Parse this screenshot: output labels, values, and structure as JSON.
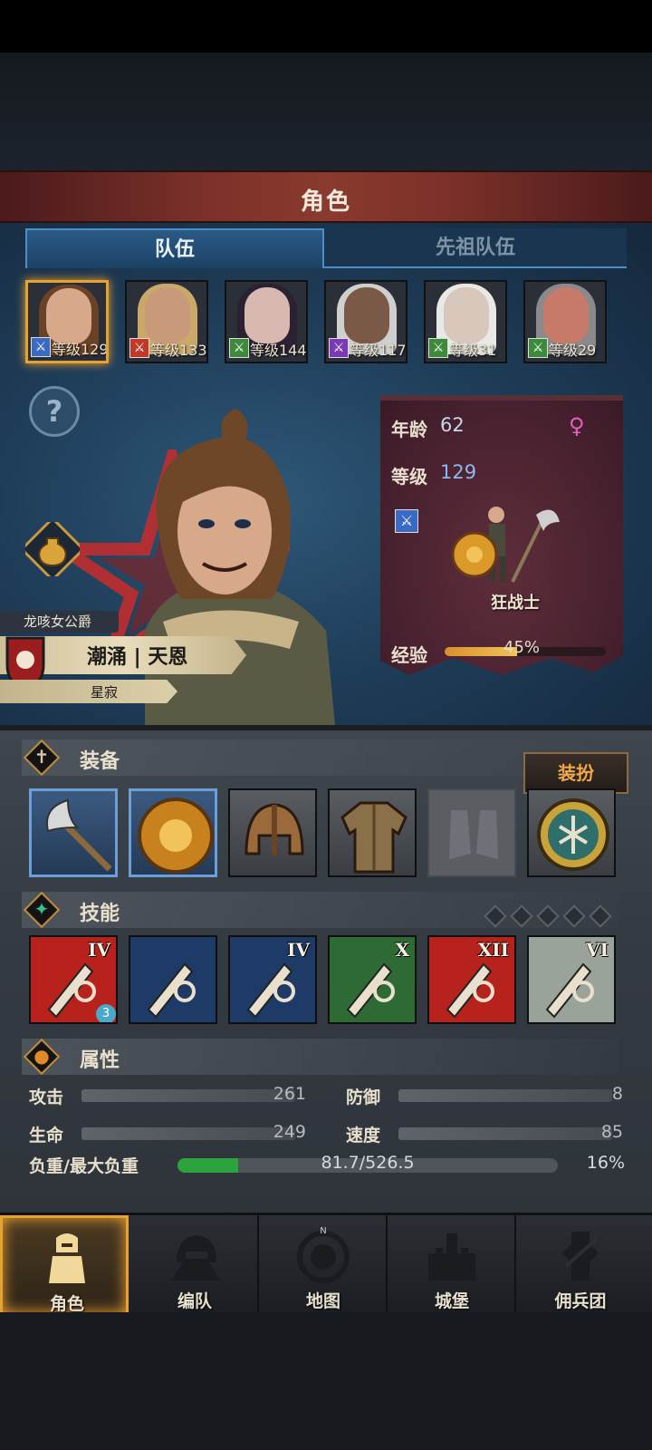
{
  "header": {
    "title": "角色"
  },
  "tabs": {
    "team": "队伍",
    "ancestors": "先祖队伍"
  },
  "roster": [
    {
      "level": "等级129",
      "badge_color": "#3a6bc4",
      "hair": "#6a4228",
      "skin": "#d7a88a",
      "selected": true
    },
    {
      "level": "等级133",
      "badge_color": "#c03a2a",
      "hair": "#c9a86a",
      "skin": "#c99a7a",
      "selected": false
    },
    {
      "level": "等级144",
      "badge_color": "#3c8a3a",
      "hair": "#2a2232",
      "skin": "#d8b8b0",
      "selected": false
    },
    {
      "level": "等级117",
      "badge_color": "#7a3ab4",
      "hair": "#cfcfd0",
      "skin": "#7a5a46",
      "selected": false
    },
    {
      "level": "等级31",
      "badge_color": "#3c8a3a",
      "hair": "#e8e8e6",
      "skin": "#d8c8bc",
      "selected": false
    },
    {
      "level": "等级29",
      "badge_color": "#3c8a3a",
      "hair": "#8a8a8c",
      "skin": "#c87a6a",
      "selected": false
    }
  ],
  "hero": {
    "title_tag": "龙咳女公爵",
    "name": "潮涌 | 天恩",
    "subtitle": "星寂"
  },
  "info": {
    "age_label": "年龄",
    "age": "62",
    "level_label": "等级",
    "level": "129",
    "class_name": "狂战士",
    "xp_label": "经验",
    "xp_text": "45%",
    "xp_fraction": 0.45
  },
  "equipment": {
    "title": "装备",
    "outfit_button": "装扮"
  },
  "skills": {
    "title": "技能",
    "items": [
      {
        "tier": "IV",
        "bg": "#b8221c"
      },
      {
        "tier": "",
        "bg": "#1e3a66"
      },
      {
        "tier": "IV",
        "bg": "#1e3a66"
      },
      {
        "tier": "X",
        "bg": "#2e6a34"
      },
      {
        "tier": "XII",
        "bg": "#b8221c"
      },
      {
        "tier": "VI",
        "bg": "#9aa39a"
      }
    ],
    "skill_badge": "3"
  },
  "attributes": {
    "title": "属性",
    "attack_label": "攻击",
    "attack": "261",
    "defense_label": "防御",
    "defense": "8",
    "hp_label": "生命",
    "hp": "249",
    "speed_label": "速度",
    "speed": "85",
    "load_label": "负重/最大负重",
    "load": "81.7/526.5",
    "load_pct": "16%",
    "load_fraction": 0.16
  },
  "nav": [
    {
      "label": "角色",
      "active": true
    },
    {
      "label": "编队",
      "active": false
    },
    {
      "label": "地图",
      "active": false
    },
    {
      "label": "城堡",
      "active": false
    },
    {
      "label": "佣兵团",
      "active": false
    }
  ],
  "nav_compass_letter": "N"
}
